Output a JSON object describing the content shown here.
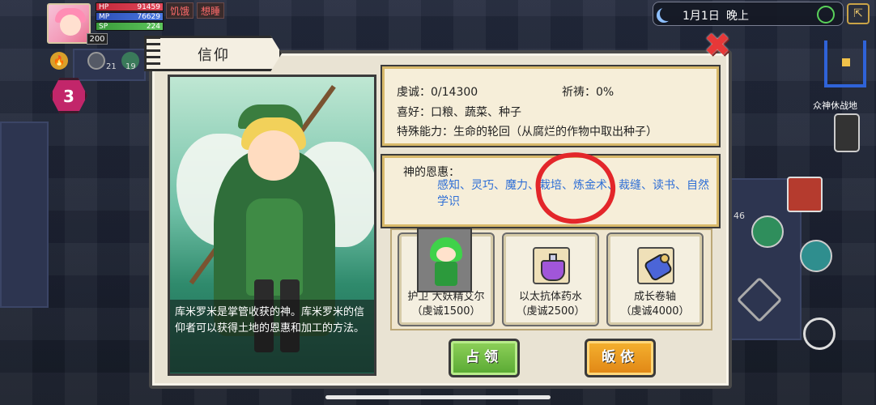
{
  "hud": {
    "hp_label": "HP",
    "hp_value": "91459",
    "mp_label": "MP",
    "mp_value": "76629",
    "sp_label": "SP",
    "sp_value": "224",
    "level": "200",
    "status_hungry": "饥饿",
    "status_sleepy": "想睡",
    "count_a": "21",
    "count_b": "19",
    "floor": "3"
  },
  "datetime": {
    "date": "1月1日",
    "period": "晚上"
  },
  "side": {
    "phone_label": "众神休战地",
    "count": "46"
  },
  "dialog": {
    "title": "信仰",
    "close": "✖",
    "description": "库米罗米是掌管收获的神。库米罗米的信仰者可以获得土地的恩惠和加工的方法。",
    "piety": "虔诚：0/14300",
    "prayer": "祈祷：0%",
    "hobby": "喜好：口粮、蔬菜、种子",
    "ability": "特殊能力：生命的轮回（从腐烂的作物中取出种子）",
    "blessing_title": "神的恩惠：",
    "blessing_text": "感知、灵巧、魔力、栽培、炼金术、裁缝、读书、自然学识",
    "rewards": [
      {
        "name": "护卫 大妖精艾尔",
        "requirement": "（虔诚1500）"
      },
      {
        "name": "以太抗体药水",
        "requirement": "（虔诚2500）"
      },
      {
        "name": "成长卷轴",
        "requirement": "（虔诚4000）"
      }
    ],
    "btn_occupy": "占领",
    "btn_convert": "皈依"
  },
  "colors": {
    "accent_blue": "#2f6fd6",
    "highlight_red": "#e3262a",
    "occupy_green": "#57a832",
    "convert_orange": "#e08514"
  }
}
